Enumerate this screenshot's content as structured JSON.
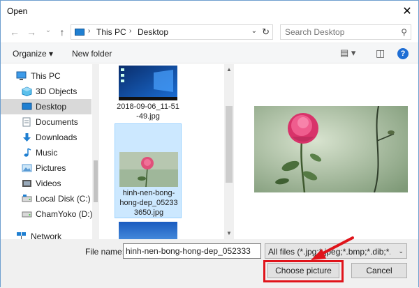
{
  "window": {
    "title": "Open",
    "close_glyph": "✕"
  },
  "nav": {
    "back_glyph": "←",
    "forward_glyph": "→",
    "recent_glyph": "⌄",
    "up_glyph": "↑",
    "crumb_sep": "›",
    "breadcrumb": [
      "This PC",
      "Desktop"
    ],
    "dropdown_glyph": "⌄",
    "refresh_glyph": "↻",
    "search_placeholder": "Search Desktop",
    "search_glyph": "⚲"
  },
  "toolbar": {
    "organize_label": "Organize ▾",
    "new_folder_label": "New folder",
    "view_glyph": "▤ ▾",
    "pane_glyph": "◫",
    "help_glyph": "?"
  },
  "sidebar": {
    "items": [
      {
        "label": "This PC",
        "icon": "computer-icon",
        "color": "#1f7fd1"
      },
      {
        "label": "3D Objects",
        "icon": "cube-icon",
        "color": "#3fa9e0"
      },
      {
        "label": "Desktop",
        "icon": "desktop-icon",
        "color": "#1f7fd1"
      },
      {
        "label": "Documents",
        "icon": "document-icon",
        "color": "#7c8d99"
      },
      {
        "label": "Downloads",
        "icon": "download-icon",
        "color": "#1f7fd1"
      },
      {
        "label": "Music",
        "icon": "music-icon",
        "color": "#1f7fd1"
      },
      {
        "label": "Pictures",
        "icon": "pictures-icon",
        "color": "#5a9bd5"
      },
      {
        "label": "Videos",
        "icon": "video-icon",
        "color": "#555555"
      },
      {
        "label": "Local Disk (C:)",
        "icon": "drive-icon",
        "color": "#7a7a7a"
      },
      {
        "label": "ChamYoko (D:)",
        "icon": "drive-icon",
        "color": "#7a7a7a"
      },
      {
        "label": "Network",
        "icon": "network-icon",
        "color": "#1f7fd1"
      }
    ]
  },
  "files": [
    {
      "name": "2018-09-06_11-51-49.jpg",
      "lines": [
        "2018-09-06_11-51",
        "-49.jpg"
      ],
      "thumb": "desktop-screenshot"
    },
    {
      "name": "hinh-nen-bong-hong-dep_052333650.jpg",
      "lines": [
        "hinh-nen-bong-",
        "hong-dep_05233",
        "3650.jpg"
      ],
      "thumb": "rose"
    },
    {
      "name": "",
      "lines": [],
      "thumb": "sky"
    }
  ],
  "bottom": {
    "file_name_label": "File name:",
    "file_name_value": "hinh-nen-bong-hong-dep_052333",
    "filter_value": "All files (*.jpg;*.jpeg;*.bmp;*.dib;*.png",
    "filter_arrow": "⌄",
    "choose_label": "Choose picture",
    "cancel_label": "Cancel"
  },
  "colors": {
    "selection": "#cce8ff",
    "highlight": "#e0141b",
    "accent": "#1f7fd1"
  }
}
